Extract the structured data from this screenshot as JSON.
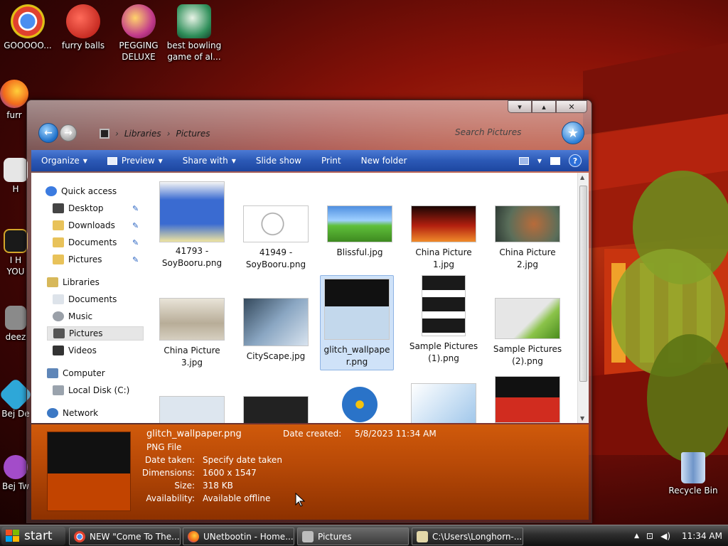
{
  "desktop": {
    "icons": [
      {
        "label": "GOOOOO...",
        "color": "#2f7be5"
      },
      {
        "label": "furry balls",
        "color": "#d6231f"
      },
      {
        "label": "PEGGING DELUXE",
        "color": "#c23b8a"
      },
      {
        "label": "best bowling game of al...",
        "color": "#2f8f5a"
      },
      {
        "label": "furr",
        "color": "#f26a1b"
      },
      {
        "label": "H",
        "color": "#e0e0e0"
      },
      {
        "label": "I H YOU",
        "color": "#d4a62a"
      },
      {
        "label": "deez",
        "color": "#7f7f7f"
      },
      {
        "label": "Bej De",
        "color": "#2ea7d8"
      },
      {
        "label": "Bej Tw",
        "color": "#a34cc9"
      },
      {
        "label": "Recycle Bin",
        "color": "#8fb4e0"
      }
    ]
  },
  "window": {
    "controls": {
      "minimize": "▾",
      "maximize": "▴",
      "close": "✕"
    },
    "breadcrumb": [
      "Libraries",
      "Pictures"
    ],
    "search_placeholder": "Search Pictures",
    "toolbar": {
      "organize": "Organize",
      "preview": "Preview",
      "share": "Share with",
      "slideshow": "Slide show",
      "print": "Print",
      "new_folder": "New folder",
      "help": "?"
    },
    "nav_pane": {
      "quick_access": "Quick access",
      "desktop": "Desktop",
      "downloads": "Downloads",
      "documents": "Documents",
      "pictures": "Pictures",
      "libraries": "Libraries",
      "lib_documents": "Documents",
      "lib_music": "Music",
      "lib_pictures": "Pictures",
      "lib_videos": "Videos",
      "computer": "Computer",
      "local_disk": "Local Disk (C:)",
      "network": "Network"
    },
    "files": [
      {
        "name": "41793 - SoyBooru.png",
        "thumb": "#3a6bd1"
      },
      {
        "name": "41949 - SoyBooru.png",
        "thumb": "#f4f4f4"
      },
      {
        "name": "Blissful.jpg",
        "thumb": "#4f9a2c"
      },
      {
        "name": "China Picture 1.jpg",
        "thumb": "#b3200f"
      },
      {
        "name": "China Picture 2.jpg",
        "thumb": "#5a6e5a"
      },
      {
        "name": "China Picture 3.jpg",
        "thumb": "#c9c1b3"
      },
      {
        "name": "CityScape.jpg",
        "thumb": "#6f8aa6"
      },
      {
        "name": "glitch_wallpaper.png",
        "thumb": "#111111"
      },
      {
        "name": "Sample Pictures (1).png",
        "thumb": "#2a2a2a"
      },
      {
        "name": "Sample Pictures (2).png",
        "thumb": "#8bc34a"
      },
      {
        "name": "",
        "thumb": "#dde6ef"
      },
      {
        "name": "",
        "thumb": "#222222"
      },
      {
        "name": "",
        "thumb": "#2a73c8"
      },
      {
        "name": "",
        "thumb": "#cfe3f5"
      },
      {
        "name": "",
        "thumb": "#d12c1f"
      }
    ],
    "details": {
      "filename": "glitch_wallpaper.png",
      "filetype": "PNG File",
      "date_created_label": "Date created:",
      "date_created": "5/8/2023 11:34 AM",
      "date_taken_label": "Date taken:",
      "date_taken": "Specify date taken",
      "dimensions_label": "Dimensions:",
      "dimensions": "1600 x 1547",
      "size_label": "Size:",
      "size": "318 KB",
      "availability_label": "Availability:",
      "availability": "Available offline"
    }
  },
  "taskbar": {
    "start": "start",
    "tasks": [
      {
        "label": "NEW \"Come To The...",
        "color": "#3c83e6"
      },
      {
        "label": "UNetbootin - Home...",
        "color": "#f26a1b"
      },
      {
        "label": "Pictures",
        "color": "#cfcfcf"
      },
      {
        "label": "C:\\Users\\Longhorn-...",
        "color": "#e3d7a8"
      }
    ],
    "clock": "11:34 AM"
  }
}
